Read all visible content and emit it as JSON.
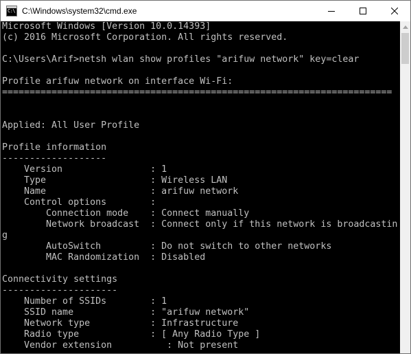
{
  "window": {
    "title": "C:\\Windows\\system32\\cmd.exe"
  },
  "icons": {
    "app": "cmd-icon",
    "minimize": "minimize-icon",
    "maximize": "maximize-icon",
    "close": "close-icon",
    "scroll_up": "chevron-up-icon"
  },
  "console": {
    "lines": [
      "Microsoft Windows [Version 10.0.14393]",
      "(c) 2016 Microsoft Corporation. All rights reserved.",
      "",
      "C:\\Users\\Arif>netsh wlan show profiles \"arifuw network\" key=clear",
      "",
      "Profile arifuw network on interface Wi-Fi:",
      "=======================================================================",
      "",
      "",
      "Applied: All User Profile",
      "",
      "Profile information",
      "-------------------",
      "    Version                : 1",
      "    Type                   : Wireless LAN",
      "    Name                   : arifuw network",
      "    Control options        :",
      "        Connection mode    : Connect manually",
      "        Network broadcast  : Connect only if this network is broadcastin",
      "g",
      "        AutoSwitch         : Do not switch to other networks",
      "        MAC Randomization  : Disabled",
      "",
      "Connectivity settings",
      "---------------------",
      "    Number of SSIDs        : 1",
      "    SSID name              : \"arifuw network\"",
      "    Network type           : Infrastructure",
      "    Radio type             : [ Any Radio Type ]",
      "    Vendor extension          : Not present"
    ]
  },
  "colors": {
    "console_bg": "#000000",
    "console_text": "#c0c0c0",
    "titlebar_bg": "#ffffff"
  }
}
